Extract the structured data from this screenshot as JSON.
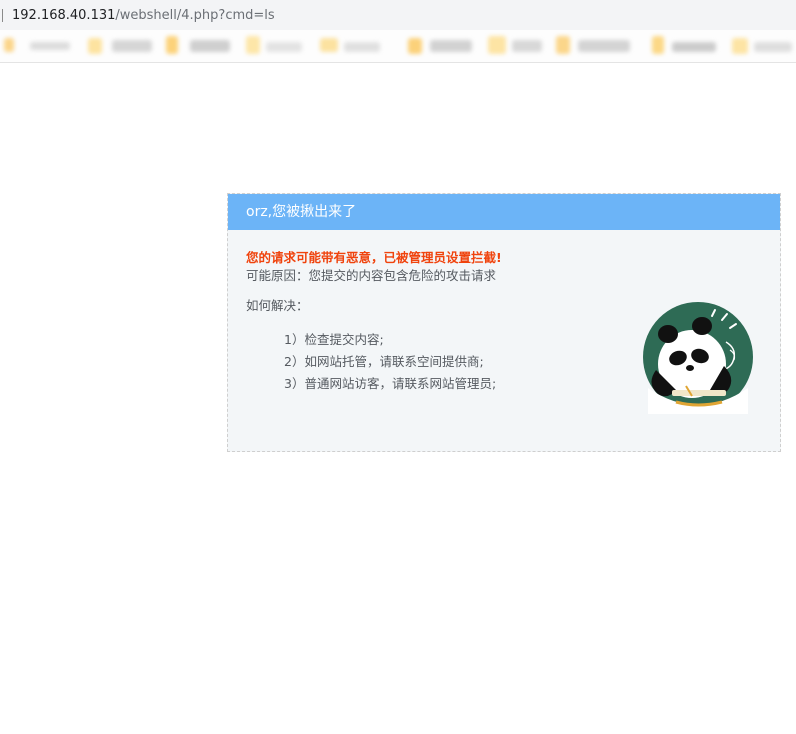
{
  "browser": {
    "url_host": "192.168.40.131",
    "url_path": "/webshell/4.php?cmd=ls"
  },
  "block_page": {
    "title": "orz,您被揪出来了",
    "warning": "您的请求可能带有恶意，已被管理员设置拦截!",
    "reason": "可能原因：您提交的内容包含危险的攻击请求",
    "how_to_resolve": "如何解决：",
    "steps": [
      "1）检查提交内容;",
      "2）如网站托管，请联系空间提供商;",
      "3）普通网站访客，请联系网站管理员;"
    ]
  },
  "colors": {
    "header_bg": "#6cb4f7",
    "warning_text": "#f0430d",
    "card_bg": "#f3f6f8",
    "panda_circle": "#2e6b55"
  },
  "icons": {
    "illustration": "panda-writing-illustration"
  }
}
